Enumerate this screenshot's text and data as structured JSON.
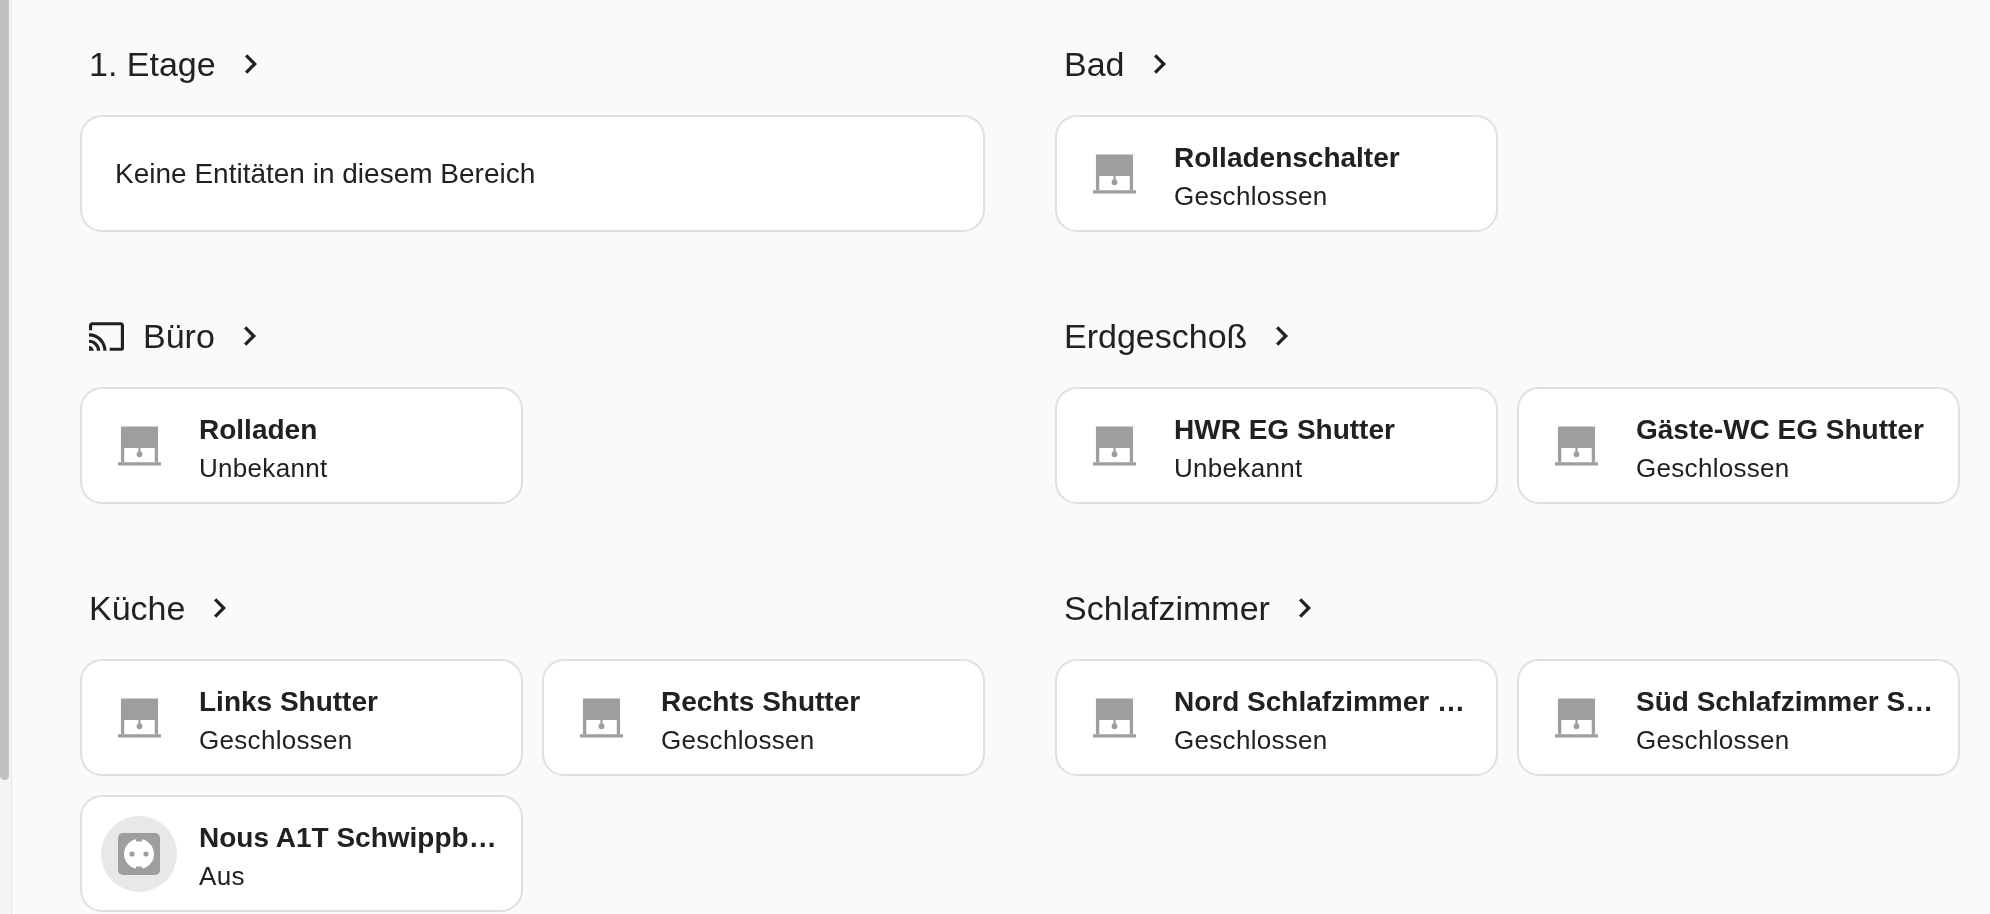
{
  "sections": [
    {
      "title": "1. Etage",
      "show_icon": false,
      "empty_message": "Keine Entitäten in diesem Bereich"
    },
    {
      "title": "Bad",
      "show_icon": false,
      "entities": [
        {
          "kind": "cover",
          "name": "Rolladenschalter",
          "state": "Geschlossen"
        }
      ]
    },
    {
      "title": "Büro",
      "show_icon": true,
      "entities": [
        {
          "kind": "cover",
          "name": "Rolladen",
          "state": "Unbekannt"
        }
      ]
    },
    {
      "title": "Erdgeschoß",
      "show_icon": false,
      "entities": [
        {
          "kind": "cover",
          "name": "HWR EG Shutter",
          "state": "Unbekannt"
        },
        {
          "kind": "cover",
          "name": "Gäste-WC EG Shutter",
          "state": "Geschlossen"
        }
      ]
    },
    {
      "title": "Küche",
      "show_icon": false,
      "entities": [
        {
          "kind": "cover",
          "name": "Links Shutter",
          "state": "Geschlossen"
        },
        {
          "kind": "cover",
          "name": "Rechts Shutter",
          "state": "Geschlossen"
        },
        {
          "kind": "switch",
          "name": "Nous A1T Schwippb…",
          "state": "Aus"
        }
      ]
    },
    {
      "title": "Schlafzimmer",
      "show_icon": false,
      "entities": [
        {
          "kind": "cover",
          "name": "Nord Schlafzimmer …",
          "state": "Geschlossen"
        },
        {
          "kind": "cover",
          "name": "Süd Schlafzimmer S…",
          "state": "Geschlossen"
        }
      ]
    }
  ]
}
